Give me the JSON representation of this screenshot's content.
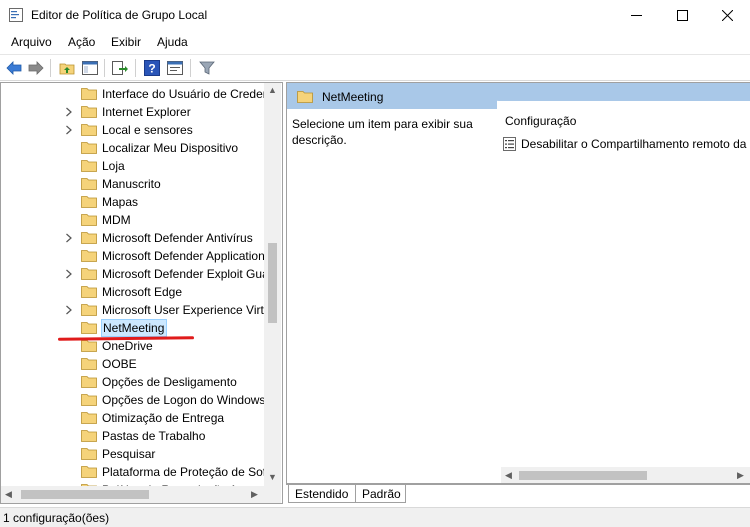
{
  "window": {
    "title": "Editor de Política de Grupo Local"
  },
  "menu": {
    "items": [
      "Arquivo",
      "Ação",
      "Exibir",
      "Ajuda"
    ]
  },
  "toolbar": {
    "buttons": [
      "back-arrow-icon",
      "forward-arrow-icon",
      "up-folder-icon",
      "show-hide-tree-icon",
      "export-list-icon",
      "help-icon",
      "properties-icon",
      "filter-icon"
    ]
  },
  "tree": {
    "items": [
      {
        "label": "Interface do Usuário de Credenciais",
        "expandable": false
      },
      {
        "label": "Internet Explorer",
        "expandable": true
      },
      {
        "label": "Local e sensores",
        "expandable": true
      },
      {
        "label": "Localizar Meu Dispositivo",
        "expandable": false
      },
      {
        "label": "Loja",
        "expandable": false
      },
      {
        "label": "Manuscrito",
        "expandable": false
      },
      {
        "label": "Mapas",
        "expandable": false
      },
      {
        "label": "MDM",
        "expandable": false
      },
      {
        "label": "Microsoft Defender Antivírus",
        "expandable": true
      },
      {
        "label": "Microsoft Defender Application Guard",
        "expandable": false
      },
      {
        "label": "Microsoft Defender Exploit Guard",
        "expandable": true
      },
      {
        "label": "Microsoft Edge",
        "expandable": false
      },
      {
        "label": "Microsoft User Experience Virtualization",
        "expandable": true
      },
      {
        "label": "NetMeeting",
        "expandable": false,
        "selected": true
      },
      {
        "label": "OneDrive",
        "expandable": false
      },
      {
        "label": "OOBE",
        "expandable": false
      },
      {
        "label": "Opções de Desligamento",
        "expandable": false
      },
      {
        "label": "Opções de Logon do Windows",
        "expandable": false
      },
      {
        "label": "Otimização de Entrega",
        "expandable": false
      },
      {
        "label": "Pastas de Trabalho",
        "expandable": false
      },
      {
        "label": "Pesquisar",
        "expandable": false
      },
      {
        "label": "Plataforma de Proteção de Software",
        "expandable": false
      },
      {
        "label": "Política de Reprodução Automática",
        "expandable": false
      }
    ]
  },
  "right_pane": {
    "header_title": "NetMeeting",
    "description": "Selecione um item para exibir sua descrição.",
    "column_header": "Configuração",
    "rows": [
      "Desabilitar o Compartilhamento remoto da área de trabalho"
    ]
  },
  "tabs": {
    "active": "Estendido",
    "inactive": "Padrão"
  },
  "status": {
    "text": "1 configuração(ões)"
  },
  "colors": {
    "selection_fill": "#cce8ff",
    "header_band": "#a9c8e8",
    "annotation_red": "#e01b1b",
    "folder_yellow": "#f5d37a"
  }
}
